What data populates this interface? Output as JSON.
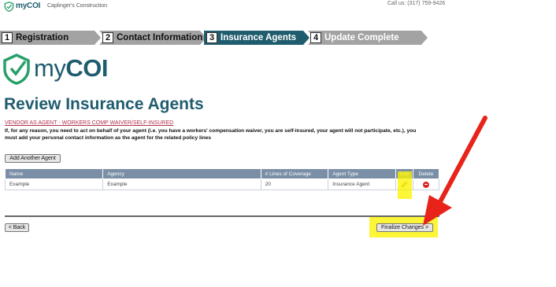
{
  "header": {
    "brand": "myCOI",
    "brand_my": "my",
    "brand_coi": "COI",
    "company": "Caplinger's Construction",
    "phone": "Call us: (317) 759-9426"
  },
  "steps": [
    {
      "number": "1",
      "label": "Registration",
      "state": "complete"
    },
    {
      "number": "2",
      "label": "Contact Information",
      "state": "complete"
    },
    {
      "number": "3",
      "label": "Insurance Agents",
      "state": "active"
    },
    {
      "number": "4",
      "label": "Update Complete",
      "state": "pending"
    }
  ],
  "page": {
    "title": "Review Insurance Agents",
    "vendor_link": "VENDOR AS AGENT - WORKERS COMP WAIVER/SELF-INSURED",
    "notice": "If, for any reason, you need to act on behalf of your agent (i.e. you have a workers' compensation waiver, you are self-insured, your agent will not participate, etc.), you must add your personal contact information as the agent for the related policy lines",
    "add_agent_label": "Add Another Agent"
  },
  "table": {
    "columns": [
      "Name",
      "Agency",
      "# Lines of Coverage",
      "Agent Type",
      "Edit",
      "Delete"
    ],
    "rows": [
      {
        "name": "Example",
        "agency": "Example",
        "lines": "20",
        "agent_type": "Insurance Agent"
      }
    ]
  },
  "footer": {
    "back_label": "< Back",
    "finalize_label": "Finalize Changes >"
  },
  "colors": {
    "brand": "#1f5c6e",
    "step_complete": "#a3a3a3",
    "step_active": "#1f5c6e",
    "table_header": "#7a8fa6",
    "highlight": "#fbf200",
    "arrow": "#e8231a"
  },
  "icons": {
    "logo": "shield-check-icon",
    "edit": "pencil-icon",
    "delete": "red-circle-delete-icon"
  }
}
